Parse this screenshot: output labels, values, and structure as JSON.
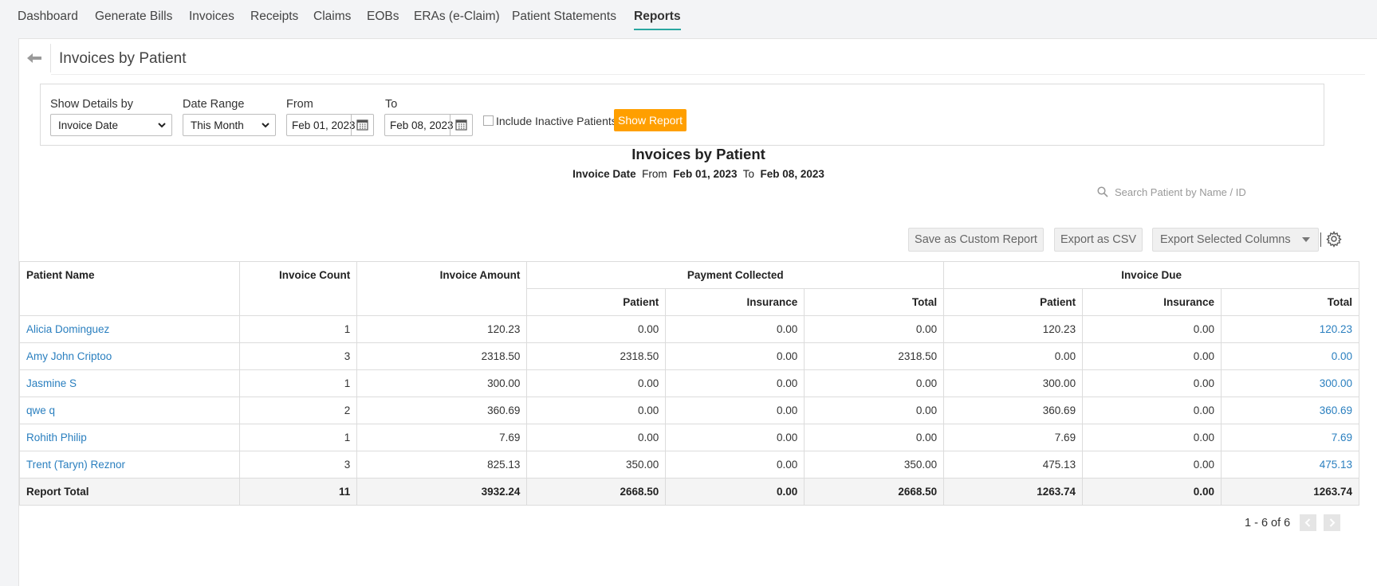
{
  "nav": {
    "tabs": [
      {
        "label": "Dashboard"
      },
      {
        "label": "Generate Bills"
      },
      {
        "label": "Invoices"
      },
      {
        "label": "Receipts"
      },
      {
        "label": "Claims"
      },
      {
        "label": "EOBs"
      },
      {
        "label": "ERAs (e-Claim)"
      },
      {
        "label": "Patient Statements"
      },
      {
        "label": "Reports"
      }
    ],
    "active": "Reports"
  },
  "page": {
    "title": "Invoices by Patient"
  },
  "filters": {
    "details_label": "Show Details by",
    "details_value": "Invoice Date",
    "range_label": "Date Range",
    "range_value": "This Month",
    "from_label": "From",
    "from_value": "Feb 01, 2023",
    "to_label": "To",
    "to_value": "Feb 08, 2023",
    "inactive_label": "Include Inactive Patients",
    "inactive_checked": false,
    "show_button": "Show Report"
  },
  "report": {
    "title": "Invoices by Patient",
    "sub_field": "Invoice Date",
    "sub_from_label": "From",
    "sub_from": "Feb 01, 2023",
    "sub_to_label": "To",
    "sub_to": "Feb 08, 2023"
  },
  "search": {
    "placeholder": "Search Patient by Name / ID"
  },
  "actions": {
    "save_custom": "Save as Custom Report",
    "export_csv": "Export as CSV",
    "export_cols": "Export Selected Columns"
  },
  "table": {
    "headers": {
      "name": "Patient Name",
      "count": "Invoice Count",
      "amount": "Invoice Amount",
      "collected": "Payment Collected",
      "due": "Invoice Due",
      "patient": "Patient",
      "insurance": "Insurance",
      "total": "Total"
    },
    "rows": [
      {
        "name": "Alicia Dominguez",
        "count": "1",
        "amount": "120.23",
        "pc_patient": "0.00",
        "pc_ins": "0.00",
        "pc_total": "0.00",
        "due_patient": "120.23",
        "due_ins": "0.00",
        "due_total": "120.23"
      },
      {
        "name": "Amy John Criptoo",
        "count": "3",
        "amount": "2318.50",
        "pc_patient": "2318.50",
        "pc_ins": "0.00",
        "pc_total": "2318.50",
        "due_patient": "0.00",
        "due_ins": "0.00",
        "due_total": "0.00"
      },
      {
        "name": "Jasmine S",
        "count": "1",
        "amount": "300.00",
        "pc_patient": "0.00",
        "pc_ins": "0.00",
        "pc_total": "0.00",
        "due_patient": "300.00",
        "due_ins": "0.00",
        "due_total": "300.00"
      },
      {
        "name": "qwe q",
        "count": "2",
        "amount": "360.69",
        "pc_patient": "0.00",
        "pc_ins": "0.00",
        "pc_total": "0.00",
        "due_patient": "360.69",
        "due_ins": "0.00",
        "due_total": "360.69"
      },
      {
        "name": "Rohith Philip",
        "count": "1",
        "amount": "7.69",
        "pc_patient": "0.00",
        "pc_ins": "0.00",
        "pc_total": "0.00",
        "due_patient": "7.69",
        "due_ins": "0.00",
        "due_total": "7.69"
      },
      {
        "name": "Trent (Taryn) Reznor",
        "count": "3",
        "amount": "825.13",
        "pc_patient": "350.00",
        "pc_ins": "0.00",
        "pc_total": "350.00",
        "due_patient": "475.13",
        "due_ins": "0.00",
        "due_total": "475.13"
      }
    ],
    "total_row": {
      "name": "Report Total",
      "count": "11",
      "amount": "3932.24",
      "pc_patient": "2668.50",
      "pc_ins": "0.00",
      "pc_total": "2668.50",
      "due_patient": "1263.74",
      "due_ins": "0.00",
      "due_total": "1263.74"
    }
  },
  "pager": {
    "text": "1 - 6 of 6"
  },
  "colors": {
    "accent": "#2aa7a0",
    "button": "#ff9f00",
    "link": "#2a7fbf"
  }
}
